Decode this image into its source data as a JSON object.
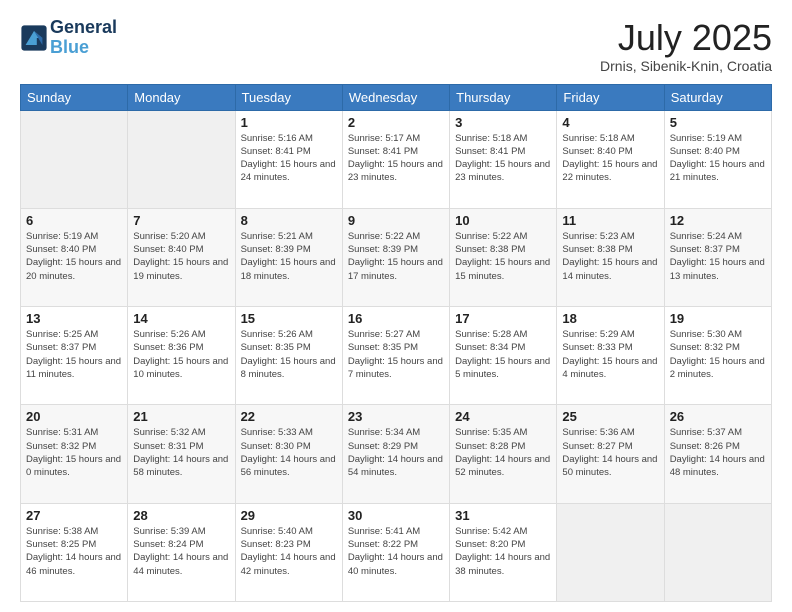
{
  "header": {
    "logo_line1": "General",
    "logo_line2": "Blue",
    "title": "July 2025",
    "subtitle": "Drnis, Sibenik-Knin, Croatia"
  },
  "weekdays": [
    "Sunday",
    "Monday",
    "Tuesday",
    "Wednesday",
    "Thursday",
    "Friday",
    "Saturday"
  ],
  "weeks": [
    [
      {
        "day": "",
        "info": ""
      },
      {
        "day": "",
        "info": ""
      },
      {
        "day": "1",
        "info": "Sunrise: 5:16 AM\nSunset: 8:41 PM\nDaylight: 15 hours\nand 24 minutes."
      },
      {
        "day": "2",
        "info": "Sunrise: 5:17 AM\nSunset: 8:41 PM\nDaylight: 15 hours\nand 23 minutes."
      },
      {
        "day": "3",
        "info": "Sunrise: 5:18 AM\nSunset: 8:41 PM\nDaylight: 15 hours\nand 23 minutes."
      },
      {
        "day": "4",
        "info": "Sunrise: 5:18 AM\nSunset: 8:40 PM\nDaylight: 15 hours\nand 22 minutes."
      },
      {
        "day": "5",
        "info": "Sunrise: 5:19 AM\nSunset: 8:40 PM\nDaylight: 15 hours\nand 21 minutes."
      }
    ],
    [
      {
        "day": "6",
        "info": "Sunrise: 5:19 AM\nSunset: 8:40 PM\nDaylight: 15 hours\nand 20 minutes."
      },
      {
        "day": "7",
        "info": "Sunrise: 5:20 AM\nSunset: 8:40 PM\nDaylight: 15 hours\nand 19 minutes."
      },
      {
        "day": "8",
        "info": "Sunrise: 5:21 AM\nSunset: 8:39 PM\nDaylight: 15 hours\nand 18 minutes."
      },
      {
        "day": "9",
        "info": "Sunrise: 5:22 AM\nSunset: 8:39 PM\nDaylight: 15 hours\nand 17 minutes."
      },
      {
        "day": "10",
        "info": "Sunrise: 5:22 AM\nSunset: 8:38 PM\nDaylight: 15 hours\nand 15 minutes."
      },
      {
        "day": "11",
        "info": "Sunrise: 5:23 AM\nSunset: 8:38 PM\nDaylight: 15 hours\nand 14 minutes."
      },
      {
        "day": "12",
        "info": "Sunrise: 5:24 AM\nSunset: 8:37 PM\nDaylight: 15 hours\nand 13 minutes."
      }
    ],
    [
      {
        "day": "13",
        "info": "Sunrise: 5:25 AM\nSunset: 8:37 PM\nDaylight: 15 hours\nand 11 minutes."
      },
      {
        "day": "14",
        "info": "Sunrise: 5:26 AM\nSunset: 8:36 PM\nDaylight: 15 hours\nand 10 minutes."
      },
      {
        "day": "15",
        "info": "Sunrise: 5:26 AM\nSunset: 8:35 PM\nDaylight: 15 hours\nand 8 minutes."
      },
      {
        "day": "16",
        "info": "Sunrise: 5:27 AM\nSunset: 8:35 PM\nDaylight: 15 hours\nand 7 minutes."
      },
      {
        "day": "17",
        "info": "Sunrise: 5:28 AM\nSunset: 8:34 PM\nDaylight: 15 hours\nand 5 minutes."
      },
      {
        "day": "18",
        "info": "Sunrise: 5:29 AM\nSunset: 8:33 PM\nDaylight: 15 hours\nand 4 minutes."
      },
      {
        "day": "19",
        "info": "Sunrise: 5:30 AM\nSunset: 8:32 PM\nDaylight: 15 hours\nand 2 minutes."
      }
    ],
    [
      {
        "day": "20",
        "info": "Sunrise: 5:31 AM\nSunset: 8:32 PM\nDaylight: 15 hours\nand 0 minutes."
      },
      {
        "day": "21",
        "info": "Sunrise: 5:32 AM\nSunset: 8:31 PM\nDaylight: 14 hours\nand 58 minutes."
      },
      {
        "day": "22",
        "info": "Sunrise: 5:33 AM\nSunset: 8:30 PM\nDaylight: 14 hours\nand 56 minutes."
      },
      {
        "day": "23",
        "info": "Sunrise: 5:34 AM\nSunset: 8:29 PM\nDaylight: 14 hours\nand 54 minutes."
      },
      {
        "day": "24",
        "info": "Sunrise: 5:35 AM\nSunset: 8:28 PM\nDaylight: 14 hours\nand 52 minutes."
      },
      {
        "day": "25",
        "info": "Sunrise: 5:36 AM\nSunset: 8:27 PM\nDaylight: 14 hours\nand 50 minutes."
      },
      {
        "day": "26",
        "info": "Sunrise: 5:37 AM\nSunset: 8:26 PM\nDaylight: 14 hours\nand 48 minutes."
      }
    ],
    [
      {
        "day": "27",
        "info": "Sunrise: 5:38 AM\nSunset: 8:25 PM\nDaylight: 14 hours\nand 46 minutes."
      },
      {
        "day": "28",
        "info": "Sunrise: 5:39 AM\nSunset: 8:24 PM\nDaylight: 14 hours\nand 44 minutes."
      },
      {
        "day": "29",
        "info": "Sunrise: 5:40 AM\nSunset: 8:23 PM\nDaylight: 14 hours\nand 42 minutes."
      },
      {
        "day": "30",
        "info": "Sunrise: 5:41 AM\nSunset: 8:22 PM\nDaylight: 14 hours\nand 40 minutes."
      },
      {
        "day": "31",
        "info": "Sunrise: 5:42 AM\nSunset: 8:20 PM\nDaylight: 14 hours\nand 38 minutes."
      },
      {
        "day": "",
        "info": ""
      },
      {
        "day": "",
        "info": ""
      }
    ]
  ]
}
